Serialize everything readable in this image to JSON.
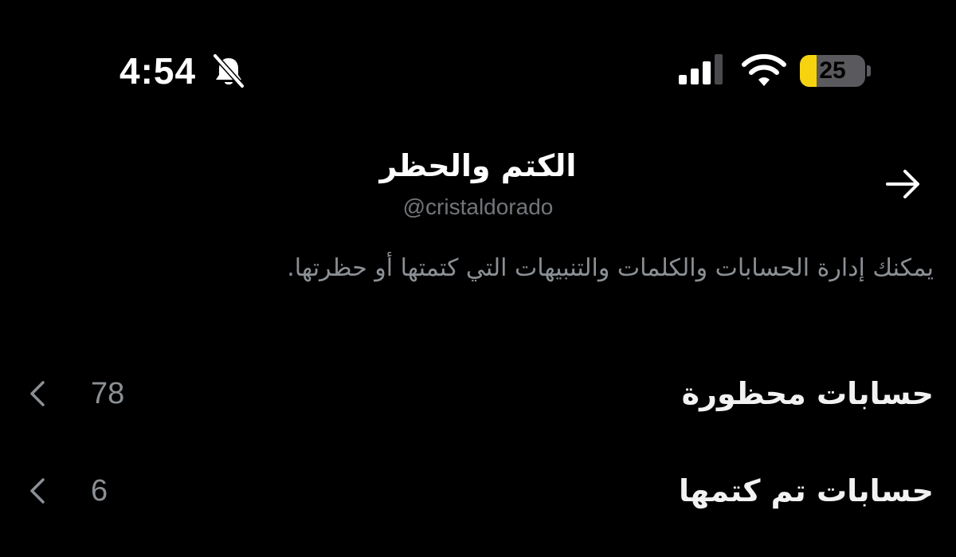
{
  "status_bar": {
    "time": "4:54",
    "silent_icon": "bell-slash-icon",
    "signal_icon": "cellular-signal-icon",
    "wifi_icon": "wifi-icon",
    "battery_level": "25",
    "battery_fraction": 0.25,
    "battery_color": "#f7d30f"
  },
  "header": {
    "title": "الكتم والحظر",
    "handle": "@cristaldorado",
    "back_icon": "arrow-right-icon"
  },
  "description": "يمكنك إدارة الحسابات والكلمات والتنبيهات التي كتمتها أو حظرتها.",
  "list": {
    "items": [
      {
        "label": "حسابات محظورة",
        "count": "78",
        "icon": "chevron-left-icon"
      },
      {
        "label": "حسابات تم كتمها",
        "count": "6",
        "icon": "chevron-left-icon"
      }
    ]
  },
  "colors": {
    "background": "#000000",
    "primary_text": "#ffffff",
    "secondary_text": "#8b9095"
  }
}
